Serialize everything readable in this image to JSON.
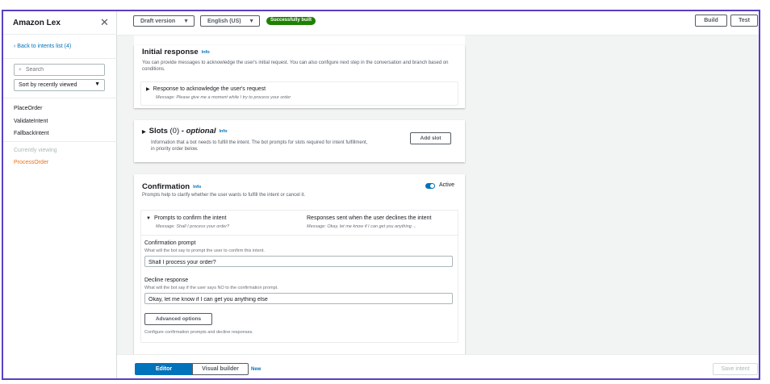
{
  "sidebar": {
    "title": "Amazon Lex",
    "close": "✕",
    "back_link": "Back to intents list (4)",
    "search_placeholder": "Search",
    "sort_label": "Sort by recently viewed",
    "intents": [
      "PlaceOrder",
      "ValidateIntent",
      "FallbackIntent"
    ],
    "currently_viewing_label": "Currently viewing",
    "current_intent": "ProcessOrder"
  },
  "topbar": {
    "version": "Draft version",
    "language": "English (US)",
    "status": "Successfully built",
    "build": "Build",
    "test": "Test"
  },
  "initial_response": {
    "title": "Initial response",
    "info": "Info",
    "description": "You can provide messages to acknowledge the user's initial request. You can also configure next step in the conversation and branch based on conditions.",
    "sub_title": "Response to acknowledge the user's request",
    "sub_message": "Message: Please give me a moment while I try to process your order"
  },
  "slots": {
    "title": "Slots",
    "count": "(0)",
    "optional": "- optional",
    "info": "Info",
    "description": "Information that a bot needs to fulfill the intent. The bot prompts for slots required for intent fulfillment, in priority order below.",
    "add_slot": "Add slot"
  },
  "confirmation": {
    "title": "Confirmation",
    "info": "Info",
    "active_label": "Active",
    "active": true,
    "description": "Prompts help to clarify whether the user wants to fulfill the intent or cancel it.",
    "prompts_title": "Prompts to confirm the intent",
    "prompts_message": "Message: Shall I process your order?",
    "decline_title": "Responses sent when the user declines the intent",
    "decline_message": "Message: Okay, let me know if I can get you anything ...",
    "prompt_label": "Confirmation prompt",
    "prompt_hint": "What will the bot say to prompt the user to confirm this intent.",
    "prompt_value": "Shall I process your order?",
    "decline_label": "Decline response",
    "decline_hint": "What will the bot say if the user says NO to the confirmation prompt.",
    "decline_value": "Okay, let me know if I can get you anything else",
    "advanced": "Advanced options",
    "footer": "Configure confirmation prompts and decline responses."
  },
  "bottombar": {
    "editor": "Editor",
    "visual_builder": "Visual builder",
    "new_badge": "New",
    "save": "Save intent"
  }
}
